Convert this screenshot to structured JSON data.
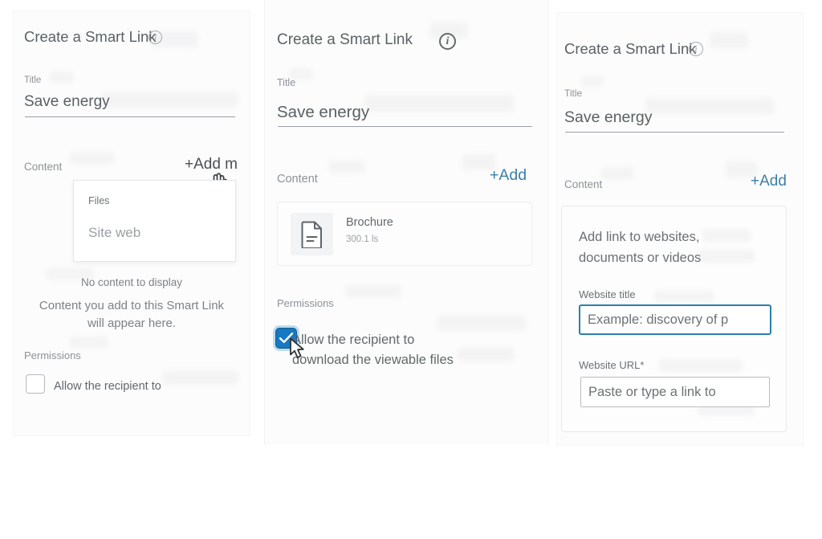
{
  "panel1": {
    "heading": "Create a Smart Link",
    "info_icon": "info-icon",
    "title_label": "Title",
    "title_value": "Save energy",
    "content_label": "Content",
    "add_label": "+Add m",
    "dropdown": {
      "group_label": "Files",
      "items": [
        "Site web"
      ]
    },
    "empty_title": "No content to display",
    "empty_line1": "Content you add to this Smart Link",
    "empty_line2": "will appear here.",
    "permissions_label": "Permissions",
    "permission_text": "Allow the recipient to",
    "permission_checked": false,
    "cursor": "pointing-hand-cursor"
  },
  "panel2": {
    "heading": "Create a Smart Link",
    "info_icon": "info-icon",
    "title_label": "Title",
    "title_value": "Save energy",
    "content_label": "Content",
    "add_label": "+Add",
    "file": {
      "name": "Brochure",
      "size": "300.1 ls",
      "icon": "document-icon"
    },
    "permissions_label": "Permissions",
    "permission_text": "Allow the recipient to download the viewable files",
    "permission_checked": true,
    "cursor": "arrow-cursor"
  },
  "panel3": {
    "heading": "Create a Smart Link",
    "info_icon": "info-icon",
    "title_label": "Title",
    "title_value": "Save energy",
    "content_label": "Content",
    "add_label": "+Add",
    "card": {
      "heading": "Add link to websites, documents or videos",
      "website_title_label": "Website title",
      "website_title_placeholder": "Example: discovery of p",
      "website_url_label": "Website URL*",
      "website_url_placeholder": "Paste or type a link to"
    },
    "cursor": "text-caret-cursor"
  },
  "colors": {
    "accent_blue": "#2c7fae",
    "link_blue": "#3d7fa8",
    "checkbox_blue": "#1878c0",
    "text_gray": "#5b6166",
    "muted_gray": "#8d9298",
    "panel_bg": "#fcfcfc"
  }
}
